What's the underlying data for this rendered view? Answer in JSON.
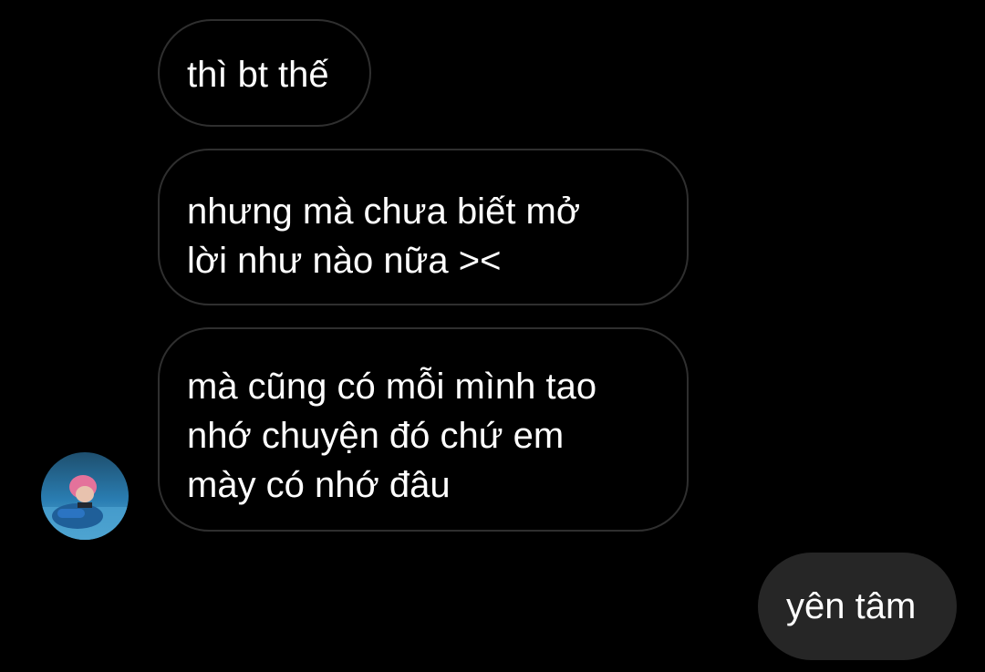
{
  "conversation": {
    "messages": [
      {
        "direction": "received",
        "text": "thì bt thế"
      },
      {
        "direction": "received",
        "text": "nhưng mà chưa biết mở\nlời như nào nữa ><"
      },
      {
        "direction": "received",
        "text": "mà cũng có mỗi mình tao\nnhớ chuyện đó chứ em\nmày có nhớ đâu"
      },
      {
        "direction": "sent",
        "text": "yên tâm"
      }
    ],
    "contact": {
      "avatar_icon": "profile-photo-avatar"
    }
  },
  "colors": {
    "background": "#000000",
    "received_bubble_border": "#2f2f2f",
    "sent_bubble_fill": "#262626",
    "text": "#ffffff"
  }
}
